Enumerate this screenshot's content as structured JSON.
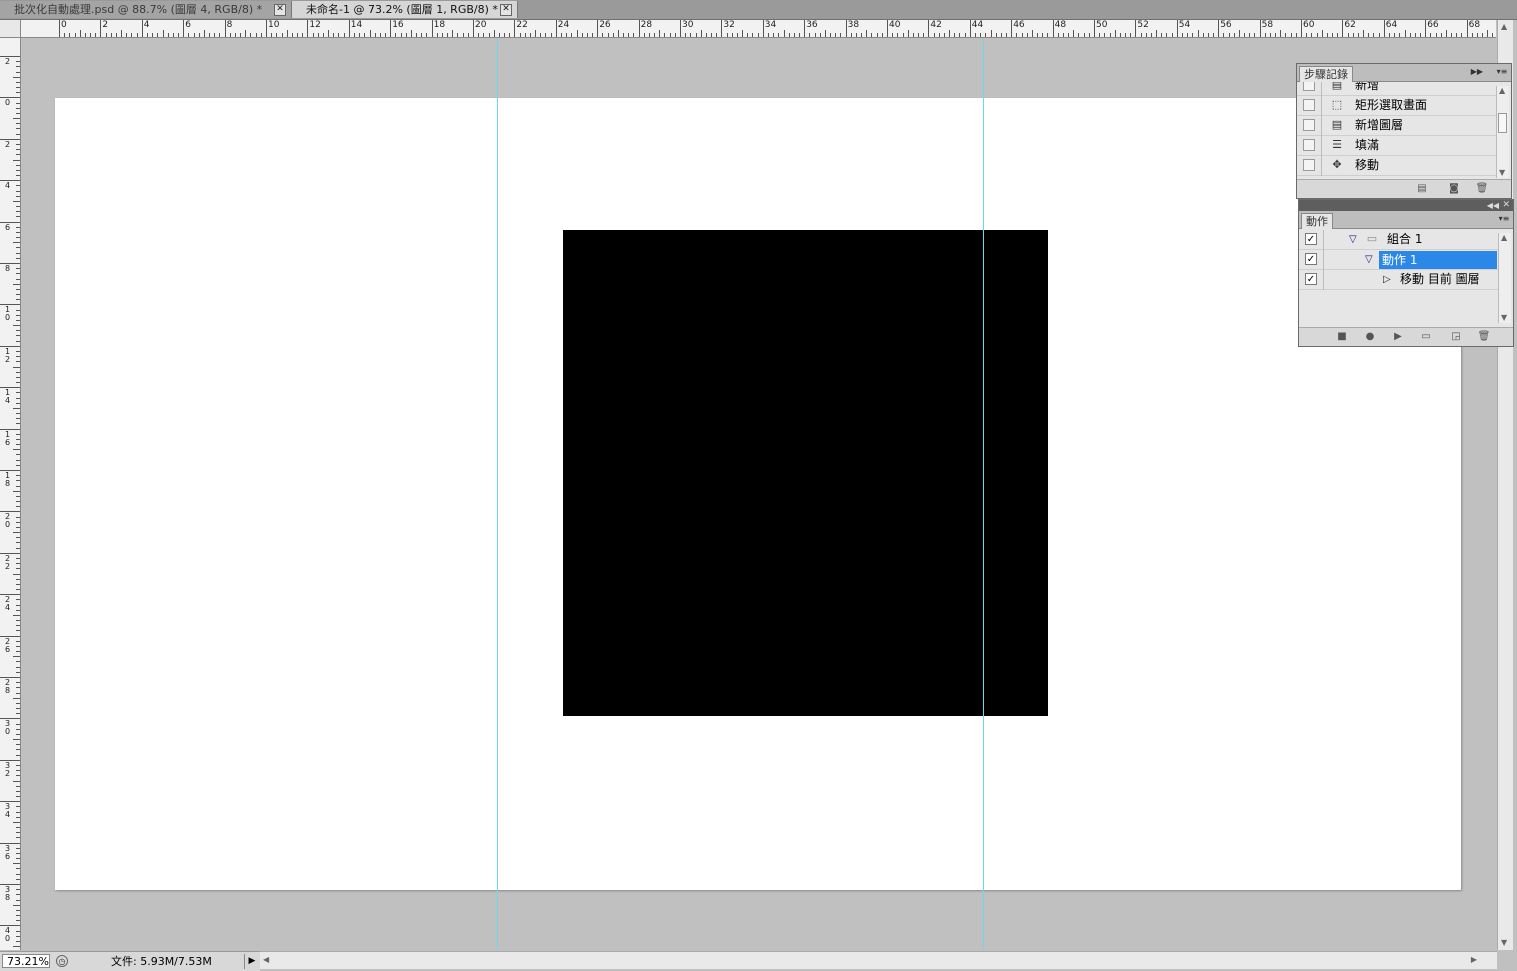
{
  "tabs": [
    {
      "label": "批次化自動處理.psd @ 88.7% (圖層 4, RGB/8) *",
      "active": false
    },
    {
      "label": "未命名-1 @ 73.2% (圖層 1, RGB/8) *",
      "active": true
    }
  ],
  "tab_close_glyph": "✕",
  "ruler_h_labels": [
    "0",
    "2",
    "4",
    "6",
    "8",
    "10",
    "12",
    "14",
    "16",
    "18",
    "20",
    "22",
    "24",
    "26",
    "28",
    "30",
    "32",
    "34",
    "36",
    "38",
    "40",
    "42",
    "44",
    "46",
    "48",
    "50",
    "52",
    "54",
    "56",
    "58",
    "60",
    "62",
    "64",
    "66",
    "68"
  ],
  "ruler_v_labels": [
    "2",
    "0",
    "2",
    "4",
    "6",
    "8",
    "10",
    "12",
    "14",
    "16",
    "18",
    "20",
    "22",
    "24",
    "26",
    "28",
    "30",
    "32",
    "34",
    "36",
    "38",
    "40"
  ],
  "status": {
    "zoom": "73.21%",
    "doc_info": "文件: 5.93M/7.53M",
    "menu_glyph": "▶"
  },
  "history_panel": {
    "tab": "步驟記錄",
    "items": [
      {
        "icon": "new-document-icon",
        "label": "新增"
      },
      {
        "icon": "rectangular-marquee-icon",
        "label": "矩形選取畫面"
      },
      {
        "icon": "new-layer-icon",
        "label": "新增圖層"
      },
      {
        "icon": "fill-icon",
        "label": "填滿"
      },
      {
        "icon": "move-tool-icon",
        "label": "移動"
      }
    ]
  },
  "actions_panel": {
    "tab": "動作",
    "items": [
      {
        "checked": true,
        "label": "組合 1",
        "type": "set"
      },
      {
        "checked": true,
        "label": "動作 1",
        "type": "action",
        "selected": true
      },
      {
        "checked": true,
        "label": "移動 目前 圖層",
        "type": "step"
      }
    ],
    "check_glyph": "✓"
  },
  "colors": {
    "guide": "#6fd8e6",
    "selection": "#2b88e8",
    "canvas_bg": "#c0c0c0",
    "document": "#ffffff",
    "shape": "#000000"
  }
}
